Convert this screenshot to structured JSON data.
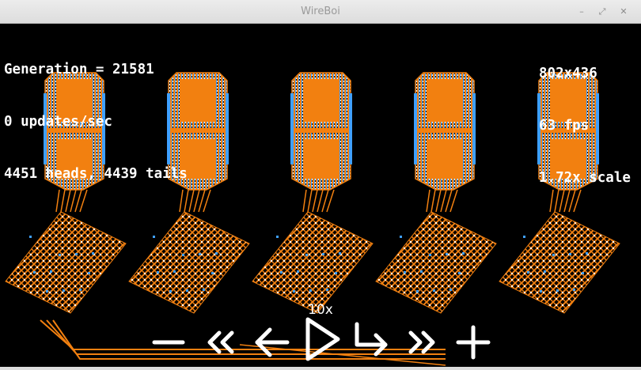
{
  "window": {
    "title": "WireBoi"
  },
  "hud": {
    "generation": "Generation = 21581",
    "updates": "0 updates/sec",
    "cells": "4451 heads, 4439 tails",
    "resolution": "802x436",
    "fps": "63 fps",
    "scale": "1.72x scale"
  },
  "controls": {
    "speed_label": "10x",
    "zoom_out_icon": "minus-icon",
    "rewind_icon": "double-chevron-left-icon",
    "back_icon": "arrow-left-icon",
    "play_icon": "play-triangle-icon",
    "step_icon": "step-arrow-icon",
    "fast_forward_icon": "double-chevron-right-icon",
    "zoom_in_icon": "plus-icon"
  },
  "colors": {
    "background": "#000000",
    "conductor": "#f28010",
    "electron_head": "#3fa0ff",
    "electron_tail": "#ffffff"
  }
}
